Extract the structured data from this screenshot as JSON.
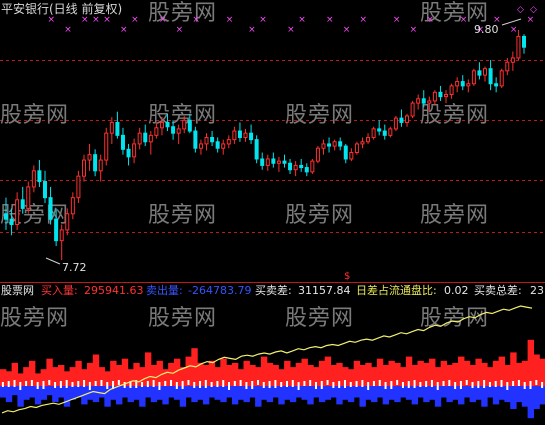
{
  "header": {
    "title": "平安银行(日线 前复权)"
  },
  "watermark_text": "股旁网",
  "price_chart": {
    "high_label": "9.80",
    "low_label": "7.72",
    "marker_glyph": "$",
    "signal_glyph": "×",
    "up_color": "#ff3030",
    "down_color": "#00e5ee",
    "grid_color": "#c01818",
    "signal_color": "#ff4cff",
    "y_range": [
      7.6,
      10.0
    ],
    "candles": [
      [
        8.15,
        8.3,
        8.0,
        8.1
      ],
      [
        8.1,
        8.2,
        7.95,
        8.05
      ],
      [
        8.05,
        8.35,
        8.0,
        8.28
      ],
      [
        8.28,
        8.4,
        8.15,
        8.2
      ],
      [
        8.2,
        8.45,
        8.15,
        8.4
      ],
      [
        8.4,
        8.6,
        8.35,
        8.55
      ],
      [
        8.55,
        8.65,
        8.4,
        8.45
      ],
      [
        8.45,
        8.55,
        8.25,
        8.3
      ],
      [
        8.3,
        8.4,
        8.05,
        8.1
      ],
      [
        8.1,
        8.2,
        7.85,
        7.9
      ],
      [
        7.9,
        8.05,
        7.72,
        8.0
      ],
      [
        8.0,
        8.2,
        7.95,
        8.15
      ],
      [
        8.15,
        8.35,
        8.1,
        8.3
      ],
      [
        8.3,
        8.55,
        8.25,
        8.5
      ],
      [
        8.5,
        8.7,
        8.45,
        8.65
      ],
      [
        8.65,
        8.8,
        8.55,
        8.7
      ],
      [
        8.7,
        8.75,
        8.5,
        8.55
      ],
      [
        8.55,
        8.7,
        8.45,
        8.65
      ],
      [
        8.65,
        8.95,
        8.6,
        8.9
      ],
      [
        8.9,
        9.05,
        8.8,
        9.0
      ],
      [
        9.0,
        9.1,
        8.85,
        8.88
      ],
      [
        8.88,
        8.95,
        8.7,
        8.75
      ],
      [
        8.75,
        8.8,
        8.6,
        8.68
      ],
      [
        8.68,
        8.85,
        8.62,
        8.8
      ],
      [
        8.8,
        8.95,
        8.75,
        8.9
      ],
      [
        8.9,
        8.98,
        8.78,
        8.82
      ],
      [
        8.82,
        8.92,
        8.7,
        8.88
      ],
      [
        8.88,
        9.0,
        8.85,
        8.95
      ],
      [
        8.95,
        9.05,
        8.88,
        9.0
      ],
      [
        9.0,
        9.08,
        8.92,
        8.96
      ],
      [
        8.96,
        9.02,
        8.84,
        8.9
      ],
      [
        8.9,
        8.98,
        8.8,
        8.94
      ],
      [
        8.94,
        9.06,
        8.9,
        9.02
      ],
      [
        9.02,
        9.08,
        8.9,
        8.92
      ],
      [
        8.92,
        8.96,
        8.72,
        8.76
      ],
      [
        8.76,
        8.84,
        8.7,
        8.8
      ],
      [
        8.8,
        8.9,
        8.74,
        8.86
      ],
      [
        8.86,
        8.92,
        8.78,
        8.82
      ],
      [
        8.82,
        8.86,
        8.72,
        8.76
      ],
      [
        8.76,
        8.84,
        8.7,
        8.8
      ],
      [
        8.8,
        8.88,
        8.76,
        8.84
      ],
      [
        8.84,
        8.96,
        8.8,
        8.92
      ],
      [
        8.92,
        9.0,
        8.82,
        8.86
      ],
      [
        8.86,
        8.94,
        8.82,
        8.9
      ],
      [
        8.9,
        8.98,
        8.8,
        8.84
      ],
      [
        8.84,
        8.88,
        8.62,
        8.66
      ],
      [
        8.66,
        8.72,
        8.56,
        8.6
      ],
      [
        8.6,
        8.7,
        8.55,
        8.66
      ],
      [
        8.66,
        8.72,
        8.58,
        8.62
      ],
      [
        8.62,
        8.68,
        8.54,
        8.64
      ],
      [
        8.64,
        8.7,
        8.58,
        8.62
      ],
      [
        8.62,
        8.66,
        8.52,
        8.56
      ],
      [
        8.56,
        8.64,
        8.5,
        8.6
      ],
      [
        8.6,
        8.66,
        8.54,
        8.58
      ],
      [
        8.58,
        8.62,
        8.5,
        8.54
      ],
      [
        8.54,
        8.66,
        8.52,
        8.64
      ],
      [
        8.64,
        8.78,
        8.62,
        8.76
      ],
      [
        8.76,
        8.84,
        8.7,
        8.8
      ],
      [
        8.8,
        8.86,
        8.72,
        8.78
      ],
      [
        8.78,
        8.84,
        8.74,
        8.82
      ],
      [
        8.82,
        8.86,
        8.74,
        8.78
      ],
      [
        8.78,
        8.8,
        8.62,
        8.66
      ],
      [
        8.66,
        8.76,
        8.64,
        8.72
      ],
      [
        8.72,
        8.82,
        8.7,
        8.8
      ],
      [
        8.8,
        8.86,
        8.76,
        8.82
      ],
      [
        8.82,
        8.9,
        8.8,
        8.86
      ],
      [
        8.86,
        8.96,
        8.84,
        8.94
      ],
      [
        8.94,
        9.02,
        8.88,
        8.92
      ],
      [
        8.92,
        8.98,
        8.84,
        8.88
      ],
      [
        8.88,
        8.96,
        8.86,
        8.94
      ],
      [
        8.94,
        9.06,
        8.92,
        9.04
      ],
      [
        9.04,
        9.12,
        8.96,
        9.0
      ],
      [
        9.0,
        9.08,
        8.96,
        9.06
      ],
      [
        9.06,
        9.2,
        9.04,
        9.18
      ],
      [
        9.18,
        9.26,
        9.12,
        9.22
      ],
      [
        9.22,
        9.3,
        9.14,
        9.18
      ],
      [
        9.18,
        9.24,
        9.1,
        9.2
      ],
      [
        9.2,
        9.3,
        9.16,
        9.28
      ],
      [
        9.28,
        9.34,
        9.2,
        9.24
      ],
      [
        9.24,
        9.3,
        9.18,
        9.26
      ],
      [
        9.26,
        9.36,
        9.22,
        9.34
      ],
      [
        9.34,
        9.42,
        9.28,
        9.38
      ],
      [
        9.38,
        9.44,
        9.3,
        9.34
      ],
      [
        9.34,
        9.4,
        9.28,
        9.36
      ],
      [
        9.36,
        9.5,
        9.34,
        9.48
      ],
      [
        9.48,
        9.56,
        9.4,
        9.44
      ],
      [
        9.44,
        9.52,
        9.38,
        9.5
      ],
      [
        9.5,
        9.58,
        9.3,
        9.36
      ],
      [
        9.36,
        9.42,
        9.28,
        9.34
      ],
      [
        9.34,
        9.5,
        9.32,
        9.48
      ],
      [
        9.48,
        9.6,
        9.44,
        9.56
      ],
      [
        9.56,
        9.66,
        9.48,
        9.6
      ],
      [
        9.6,
        9.86,
        9.58,
        9.8
      ],
      [
        9.8,
        9.82,
        9.64,
        9.7
      ]
    ],
    "signal_rows": [
      [
        8,
        14,
        16,
        18,
        23,
        28,
        34,
        40,
        46,
        53,
        58,
        64,
        70,
        76,
        82,
        88,
        94
      ],
      [
        11,
        21,
        31,
        44,
        51,
        61,
        73,
        85,
        91
      ]
    ]
  },
  "indicator": {
    "prefix_label": "股票网",
    "buy_label": "买入量:",
    "buy_value": "295941.63",
    "sell_label": "卖出量:",
    "sell_value": "-264783.79",
    "diff_label": "买卖差:",
    "diff_value": "31157.84",
    "ratio_label": "日差占流通盘比:",
    "ratio_value": "0.02",
    "total_label": "买卖总差:",
    "total_value": "23",
    "colors": {
      "red": "#ff2020",
      "blue": "#2233ff",
      "white": "#ffffff",
      "yellow": "#f0f070"
    },
    "buy_volumes": [
      8,
      7,
      11,
      6,
      9,
      12,
      6,
      8,
      13,
      9,
      10,
      7,
      9,
      12,
      8,
      11,
      15,
      9,
      7,
      12,
      10,
      13,
      8,
      11,
      9,
      16,
      10,
      12,
      8,
      11,
      13,
      9,
      14,
      18,
      11,
      10,
      12,
      9,
      13,
      10,
      11,
      8,
      12,
      10,
      9,
      14,
      11,
      10,
      8,
      12,
      9,
      11,
      13,
      10,
      9,
      12,
      14,
      10,
      11,
      9,
      8,
      12,
      10,
      11,
      9,
      13,
      10,
      12,
      11,
      9,
      14,
      10,
      12,
      11,
      13,
      9,
      12,
      10,
      11,
      14,
      12,
      10,
      13,
      11,
      9,
      12,
      14,
      10,
      16,
      11,
      12,
      22,
      15,
      13
    ],
    "sell_volumes": [
      5,
      7,
      4,
      9,
      6,
      5,
      8,
      6,
      4,
      7,
      5,
      9,
      6,
      5,
      8,
      6,
      7,
      5,
      9,
      6,
      8,
      5,
      7,
      6,
      9,
      5,
      7,
      6,
      8,
      5,
      6,
      9,
      5,
      7,
      6,
      8,
      5,
      6,
      7,
      5,
      8,
      6,
      7,
      5,
      9,
      6,
      7,
      5,
      8,
      6,
      7,
      5,
      6,
      8,
      5,
      7,
      6,
      5,
      8,
      6,
      7,
      5,
      9,
      6,
      7,
      5,
      8,
      6,
      7,
      5,
      6,
      8,
      5,
      7,
      6,
      9,
      5,
      7,
      6,
      8,
      5,
      7,
      6,
      9,
      5,
      8,
      6,
      7,
      10,
      7,
      9,
      14,
      10,
      8
    ],
    "cumulative_diff": [
      2,
      4,
      3,
      5,
      6,
      8,
      7,
      9,
      10,
      11,
      10,
      12,
      14,
      16,
      18,
      20,
      22,
      21,
      20,
      24,
      26,
      28,
      30,
      32,
      31,
      34,
      36,
      35,
      38,
      40,
      39,
      42,
      44,
      46,
      45,
      48,
      50,
      49,
      52,
      54,
      53,
      52,
      55,
      56,
      55,
      57,
      58,
      57,
      59,
      60,
      58,
      60,
      62,
      61,
      63,
      64,
      63,
      65,
      66,
      65,
      67,
      69,
      68,
      70,
      71,
      70,
      72,
      74,
      73,
      75,
      77,
      76,
      78,
      80,
      79,
      82,
      84,
      83,
      86,
      88,
      87,
      90,
      92,
      91,
      94,
      96,
      95,
      97,
      99,
      98,
      100,
      102,
      101,
      100
    ]
  }
}
